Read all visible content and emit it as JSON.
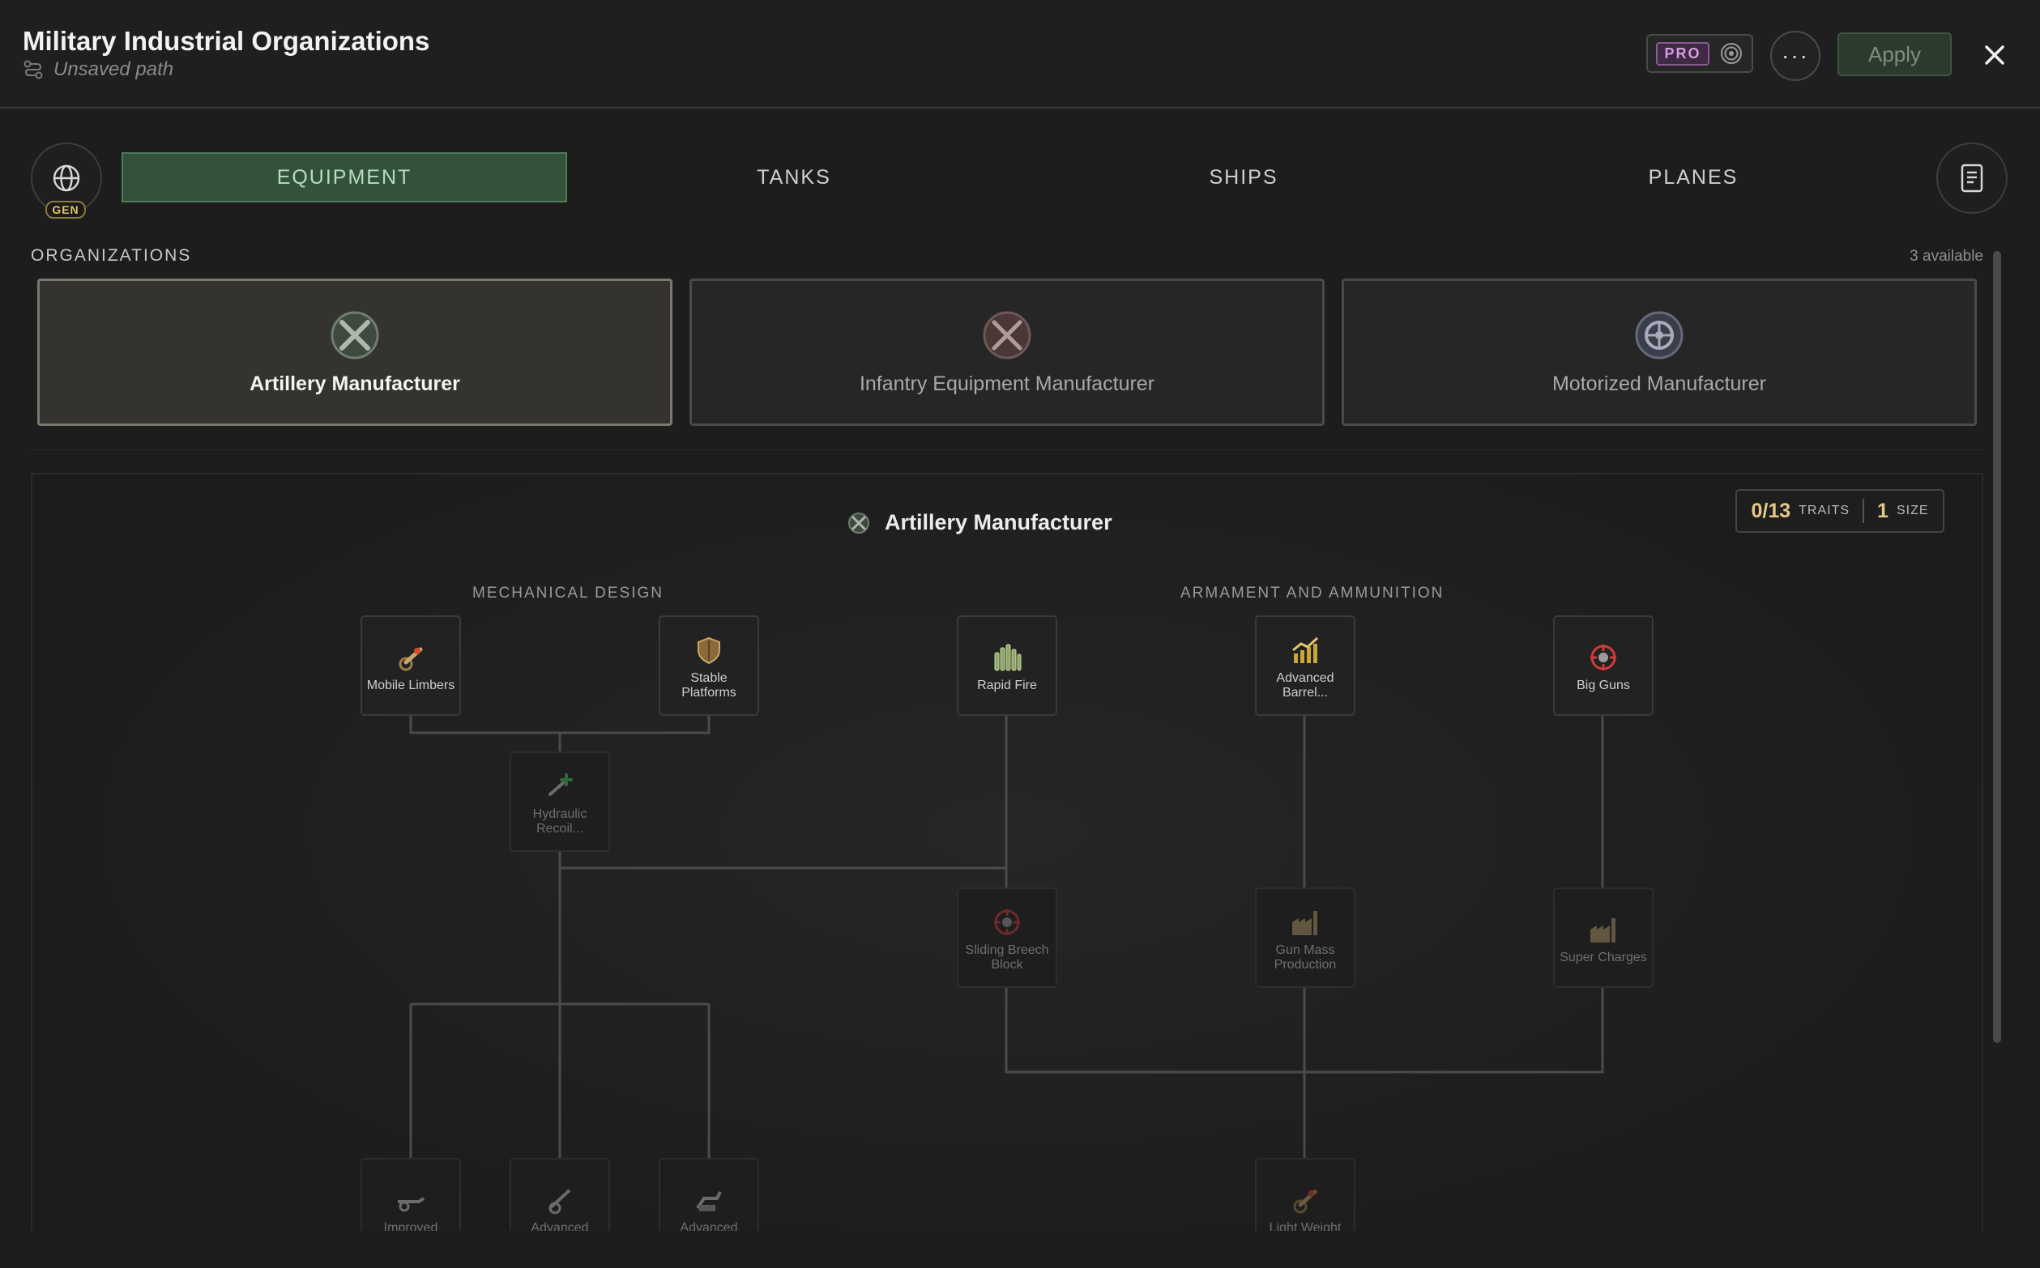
{
  "header": {
    "title": "Military Industrial Organizations",
    "subtitle": "Unsaved path",
    "pro_label": "PRO",
    "more_label": "···",
    "apply_label": "Apply"
  },
  "tabs": {
    "gen_label": "GEN",
    "items": [
      "EQUIPMENT",
      "TANKS",
      "SHIPS",
      "PLANES"
    ],
    "active": "EQUIPMENT"
  },
  "organizations": {
    "section_label": "ORGANIZATIONS",
    "available_text": "3 available",
    "items": [
      {
        "name": "Artillery Manufacturer",
        "selected": true
      },
      {
        "name": "Infantry Equipment Manufacturer",
        "selected": false
      },
      {
        "name": "Motorized Manufacturer",
        "selected": false
      }
    ]
  },
  "tree": {
    "title": "Artillery Manufacturer",
    "traits_value": "0/13",
    "traits_label": "TRAITS",
    "size_value": "1",
    "size_label": "SIZE",
    "groups": [
      "MECHANICAL DESIGN",
      "ARMAMENT AND AMMUNITION"
    ],
    "nodes": [
      {
        "label": "Mobile Limbers",
        "icon": "cannon-icon"
      },
      {
        "label": "Stable Platforms",
        "icon": "shield-icon"
      },
      {
        "label": "Hydraulic Recoil...",
        "icon": "wrench-icon"
      },
      {
        "label": "Rapid Fire",
        "icon": "shells-icon"
      },
      {
        "label": "Advanced Barrel...",
        "icon": "chart-up-icon"
      },
      {
        "label": "Big Guns",
        "icon": "crosshair-icon"
      },
      {
        "label": "Sliding Breech Block",
        "icon": "crosshair-icon"
      },
      {
        "label": "Gun Mass Production",
        "icon": "factory-icon"
      },
      {
        "label": "Super Charges",
        "icon": "factory-icon"
      },
      {
        "label": "Improved",
        "icon": "field-gun-icon"
      },
      {
        "label": "Advanced",
        "icon": "howitzer-icon"
      },
      {
        "label": "Advanced",
        "icon": "mortar-icon"
      },
      {
        "label": "Light Weight",
        "icon": "cannon-icon"
      }
    ]
  },
  "colors": {
    "accent_green": "#34513a",
    "gold": "#e6c987",
    "pro_purple": "#d79be0"
  }
}
